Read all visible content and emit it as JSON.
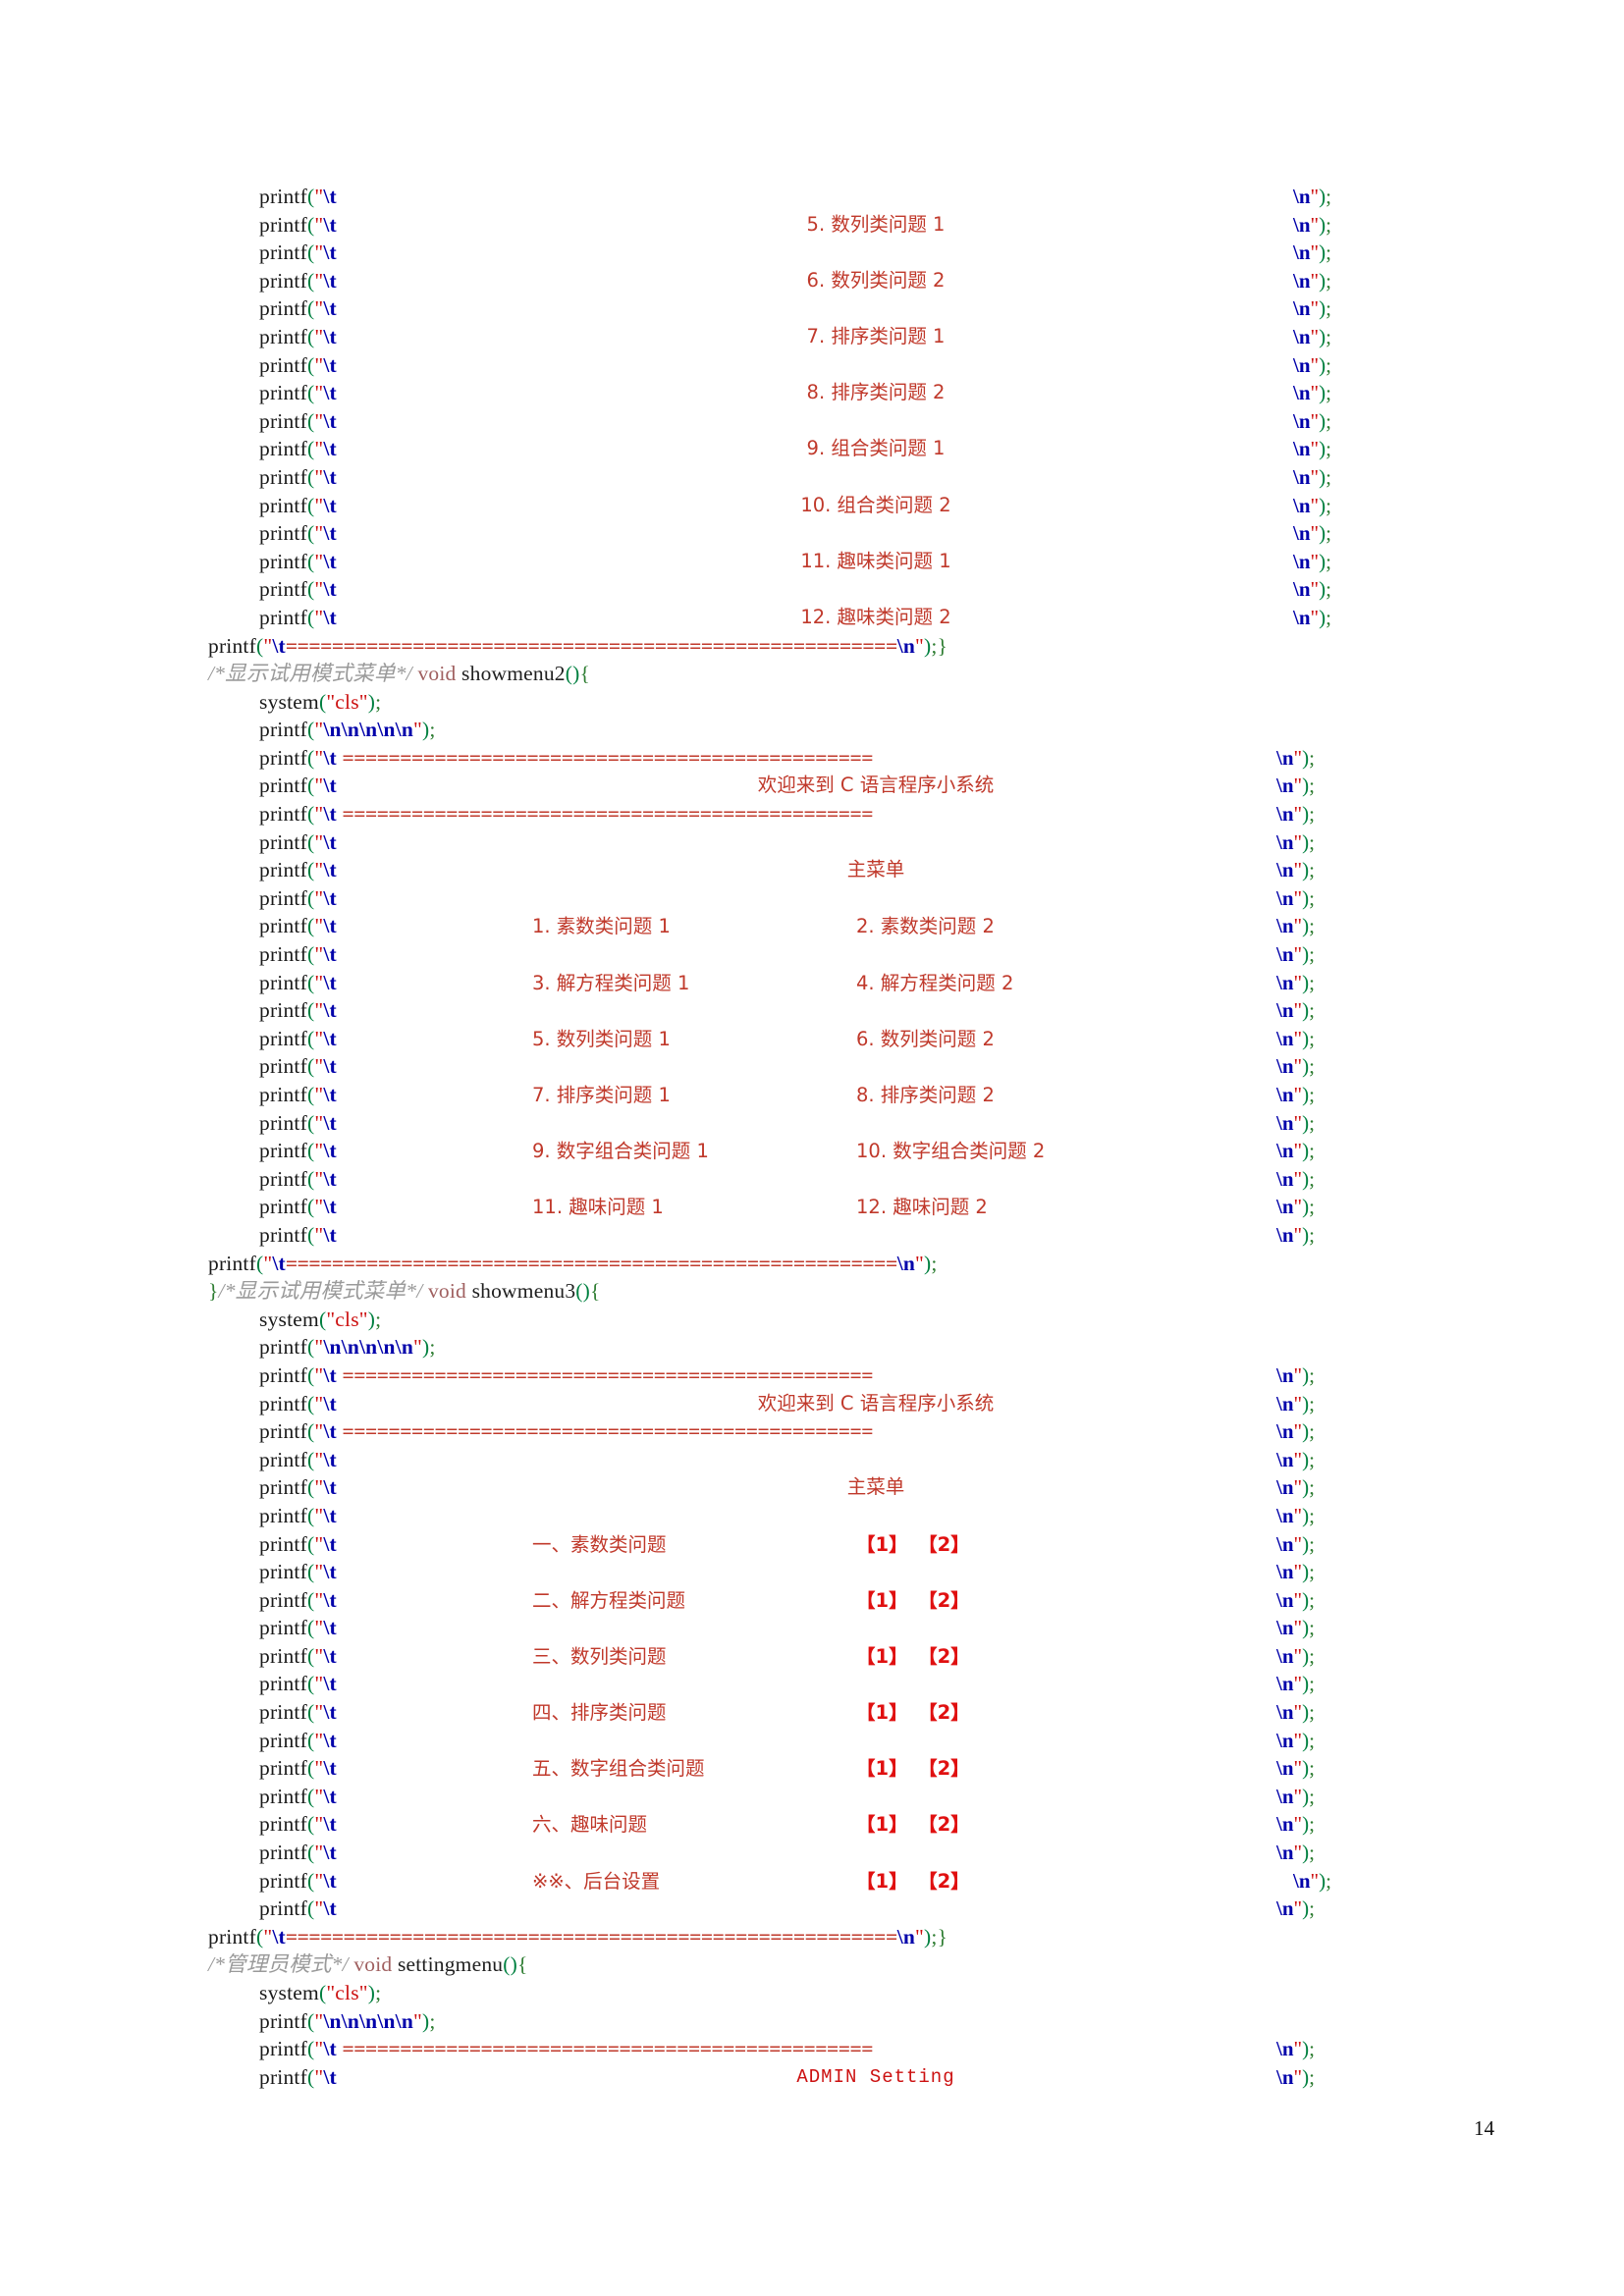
{
  "document": {
    "page_number": "14",
    "language": "C",
    "tokens": {
      "printf": "printf",
      "system": "system",
      "void": "void",
      "open_quote": "\"",
      "close_quote": "\"",
      "tab_escape": "\\t",
      "newline_escape": "\\n",
      "five_newlines": "\\n\\n\\n\\n\\n",
      "open_paren": "(",
      "close_paren": ")",
      "semicolon": ";",
      "open_brace": "{",
      "close_brace": "}",
      "cls": "cls",
      "empty_parens": "()"
    },
    "separator_rule": "==============================================",
    "separator_rule_long": "=====================================================",
    "line_tail": "\\n\");",
    "line_tail_close": "\\n\");}",
    "line_tail_plain": "\\n\");"
  },
  "section_showmenu1_tail": {
    "name": "showmenu1-tail",
    "menu_items": [
      "5. 数列类问题 1",
      "6. 数列类问题 2",
      "7. 排序类问题 1",
      "8. 排序类问题 2",
      "9. 组合类问题 1",
      "10. 组合类问题 2",
      "11. 趣味类问题 1",
      "12. 趣味类问题 2"
    ]
  },
  "section_showmenu2": {
    "comment": "/*显示试用模式菜单*/",
    "signature": "void showmenu2(){",
    "function_name": "showmenu2",
    "banner_title": "欢迎来到 C 语言程序小系统",
    "menu_heading": "主菜单",
    "menu_rows": [
      {
        "left": "1. 素数类问题 1",
        "right": "2. 素数类问题 2"
      },
      {
        "left": "3. 解方程类问题 1",
        "right": "4. 解方程类问题 2"
      },
      {
        "left": "5. 数列类问题 1",
        "right": "6. 数列类问题 2"
      },
      {
        "left": "7. 排序类问题 1",
        "right": "8. 排序类问题 2"
      },
      {
        "left": "9. 数字组合类问题 1",
        "right": "10. 数字组合类问题 2"
      },
      {
        "left": "11. 趣味问题 1",
        "right": "12. 趣味问题 2"
      }
    ]
  },
  "section_showmenu3": {
    "prefix_brace": "}",
    "comment": "/*显示试用模式菜单*/",
    "signature": "void showmenu3(){",
    "function_name": "showmenu3",
    "banner_title": "欢迎来到 C 语言程序小系统",
    "menu_heading": "主菜单",
    "menu_rows": [
      {
        "label": "一、素数类问题",
        "badge1": "【1】",
        "badge2": "【2】"
      },
      {
        "label": "二、解方程类问题",
        "badge1": "【1】",
        "badge2": "【2】"
      },
      {
        "label": "三、数列类问题",
        "badge1": "【1】",
        "badge2": "【2】"
      },
      {
        "label": "四、排序类问题",
        "badge1": "【1】",
        "badge2": "【2】"
      },
      {
        "label": "五、数字组合类问题",
        "badge1": "【1】",
        "badge2": "【2】"
      },
      {
        "label": "六、趣味问题",
        "badge1": "【1】",
        "badge2": "【2】"
      },
      {
        "label": "※※、后台设置",
        "badge1": "【1】",
        "badge2": "【2】"
      }
    ]
  },
  "section_settingmenu": {
    "comment": "/*管理员模式*/",
    "signature": "void settingmenu(){",
    "function_name": "settingmenu",
    "banner_title": "ADMIN  Setting"
  }
}
